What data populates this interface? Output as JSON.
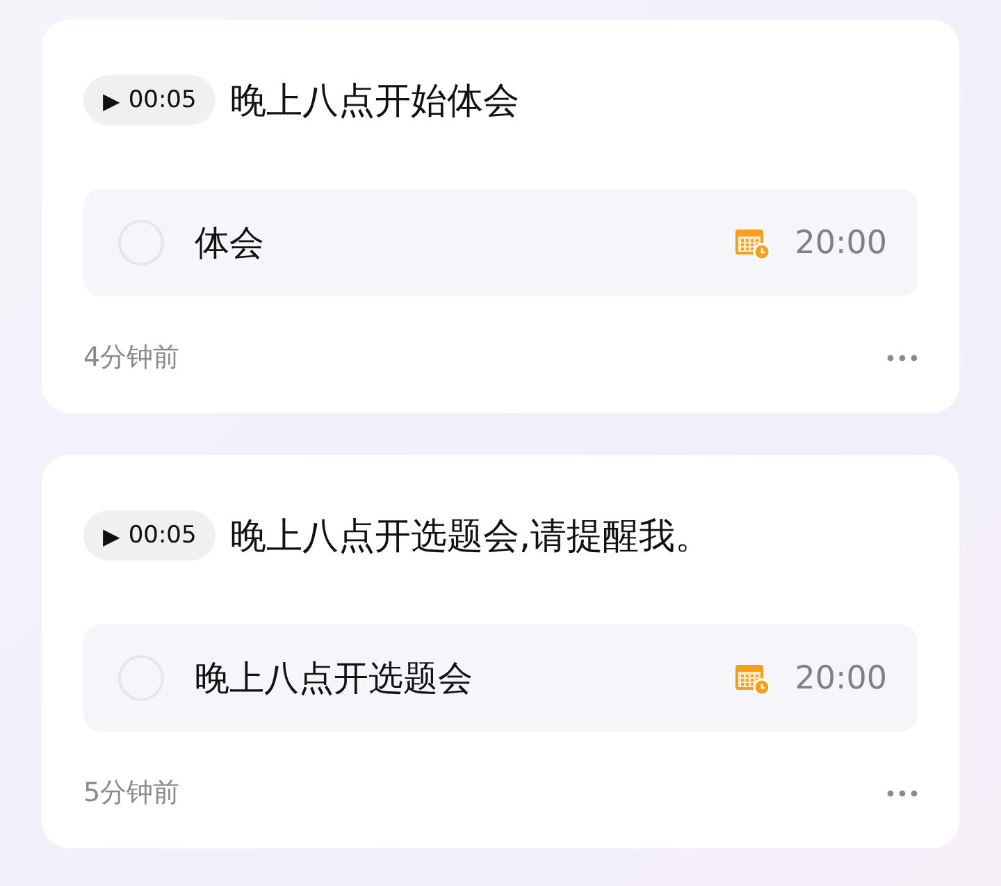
{
  "notes": [
    {
      "audio": {
        "play": "▶",
        "duration": "00:05"
      },
      "title": "晚上八点开始体会",
      "task": {
        "text": "体会",
        "checked": false,
        "time": "20:00"
      },
      "footer": "4分钟前"
    },
    {
      "audio": {
        "play": "▶",
        "duration": "00:05"
      },
      "title": "晚上八点开选题会,请提醒我。",
      "task": {
        "text": "晚上八点开选题会",
        "checked": false,
        "time": "20:00"
      },
      "footer": "5分钟前"
    }
  ]
}
